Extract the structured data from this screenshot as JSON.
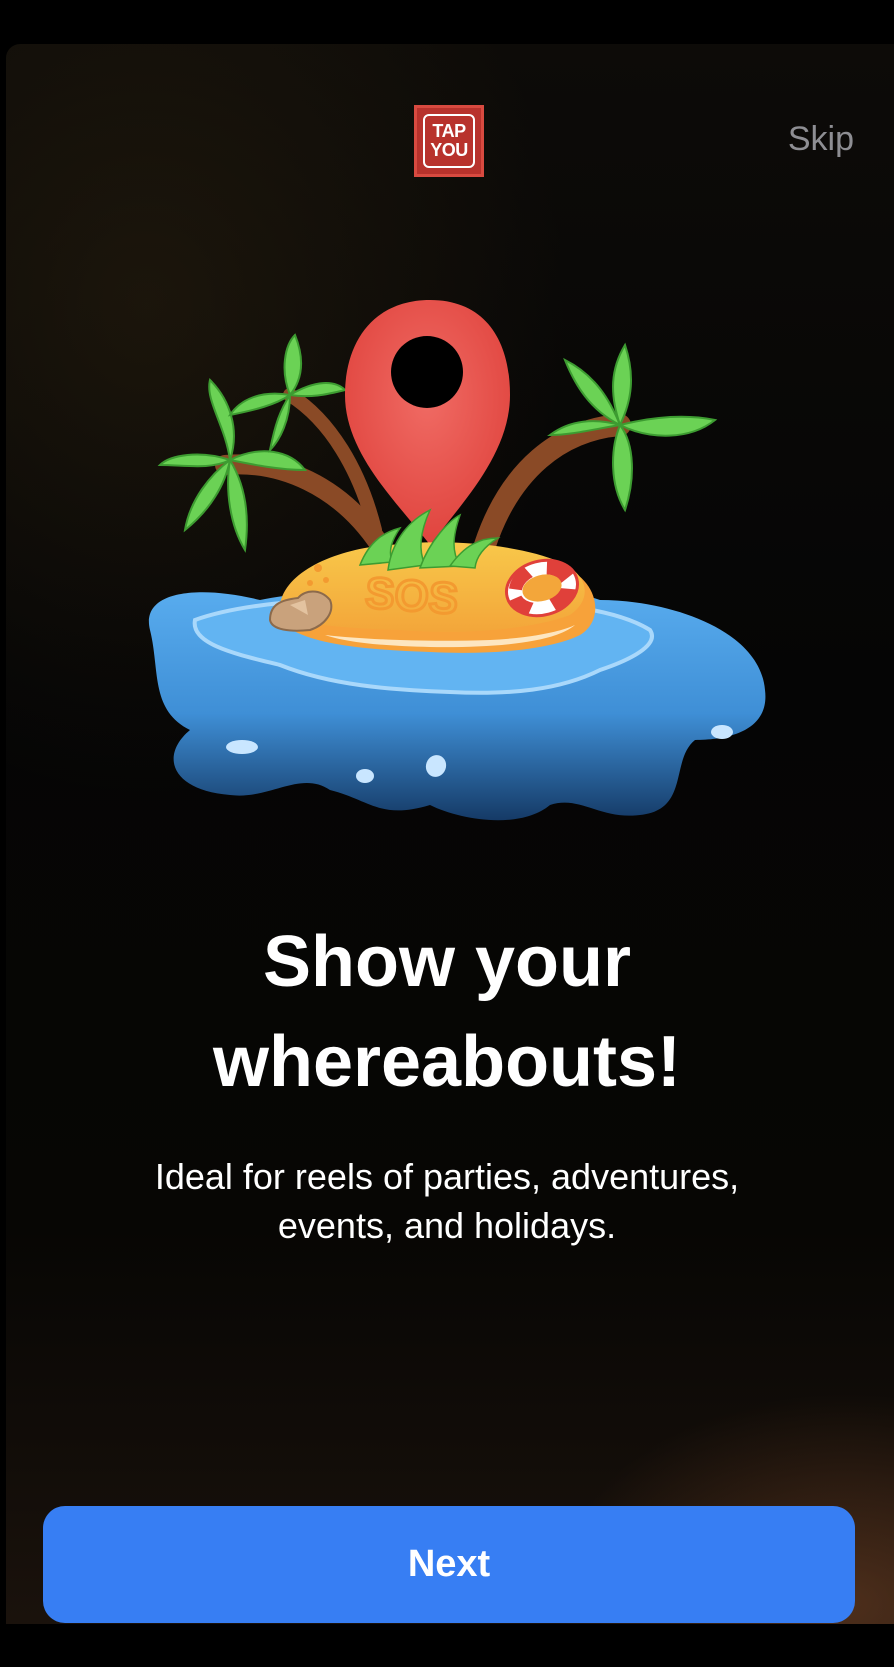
{
  "header": {
    "logo": {
      "line1": "TAP",
      "line2": "YOU",
      "color": "#b8322c"
    },
    "skip_label": "Skip"
  },
  "illustration": {
    "icon": "island-location-pin-illustration",
    "sand_text": "SOS"
  },
  "content": {
    "title_line1": "Show your",
    "title_line2": "whereabouts!",
    "subtitle_line1": "Ideal for reels of parties, adventures,",
    "subtitle_line2": "events, and holidays."
  },
  "footer": {
    "next_label": "Next",
    "accent": "#377ef3"
  }
}
